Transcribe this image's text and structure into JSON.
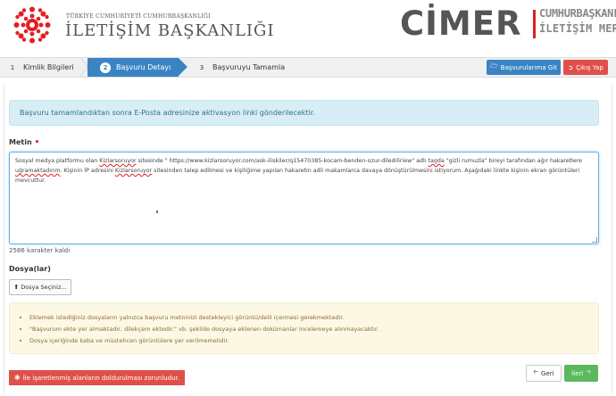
{
  "header": {
    "org_small": "TÜRKİYE CUMHURİYETİ CUMHURBAŞKANLIĞI",
    "org_big": "İLETİŞİM BAŞKANLIĞI",
    "cimer_word": "CİMER",
    "cimer_sub1": "CUMHURBAŞKANLIĞI",
    "cimer_sub2": "İLETİŞİM MERKEZİ",
    "logo_icon": "star-seal-icon",
    "accent_color": "#e31e24"
  },
  "steps": [
    {
      "num": "1",
      "label": "Kimlik Bilgileri",
      "state": "done"
    },
    {
      "num": "2",
      "label": "Başvuru Detayı",
      "state": "active"
    },
    {
      "num": "3",
      "label": "Başvuruyu Tamamla",
      "state": "pending"
    }
  ],
  "topbuttons": {
    "basvurularima_git": "Başvurularıma Git",
    "cikis_yap": "Çıkış Yap",
    "folder_icon": "folder-open-icon",
    "signout_icon": "sign-out-icon"
  },
  "info_alert": "Başvuru tamamlandıktan sonra E-Posta adresinize aktivasyon linki gönderilecektir.",
  "form": {
    "metin_label": "Metin",
    "required_marker": "•",
    "text_parts": [
      "Sosyal medya platformu olan ",
      "Kizlarsoruyor",
      " sitesinde \" https://www.kizlarsoruyor.com/ask-iliskiler/q15470385-kocam-benden-ozur-dilediliriew\" adlı ",
      "tagda",
      " \"gizli rumuzla\" bireyi tarafından ağır hakaretlere ",
      "uğramaktadırım",
      ". Kişinin İP adresini ",
      "Kizlarsoruyor",
      " sitesinden talep edilmesi ve kişiliğime yapılan hakaretin adli makamlarca davaya dönüştürülmesini istiyorum. Aşağıdaki linkte kişinin ekran görüntüleri mevcuttur."
    ],
    "chars_left": "2586 karakter kaldı",
    "dosya_label": "Dosya(lar)",
    "dosya_button": "Dosya Seçiniz...",
    "upload_icon": "upload-icon"
  },
  "warnings": [
    "Eklemek istediğiniz dosyaların yalnızca başvuru metninizi destekleyici görüntü/delil içermesi gerekmektedir.",
    "\"Başvurum ekte yer almaktadır, dilekçem ektedir.\" vb. şekilde dosyaya eklenen dokümanlar incelemeye alınmayacaktır.",
    "Dosya içeriğinde kaba ve müstehcen görüntülere yer verilmemelidir."
  ],
  "required_note": "İle işaretlenmiş alanların doldurulması zorunludur.",
  "nav": {
    "geri": "Geri",
    "ileri": "İleri",
    "back_icon": "arrow-left-icon",
    "next_icon": "arrow-right-icon"
  }
}
